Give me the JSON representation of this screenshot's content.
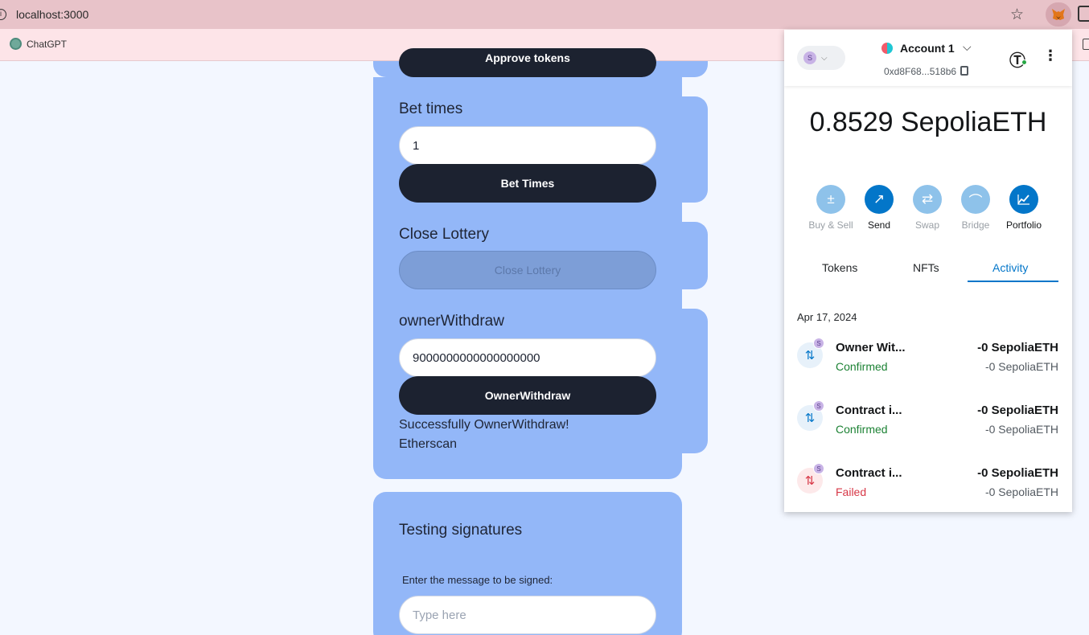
{
  "browser": {
    "url": "localhost:3000",
    "bookmarks": [
      {
        "label": "ChatGPT"
      }
    ]
  },
  "page": {
    "approve_button_partial": "Approve tokens",
    "bet_times": {
      "title": "Bet times",
      "input_value": "1",
      "button": "Bet Times"
    },
    "close_lottery": {
      "title": "Close Lottery",
      "button": "Close Lottery"
    },
    "owner_withdraw": {
      "title": "ownerWithdraw",
      "input_value": "9000000000000000000",
      "button": "OwnerWithdraw",
      "status": "Successfully OwnerWithdraw!",
      "link": "Etherscan"
    },
    "testing_signatures": {
      "title": "Testing signatures",
      "label": "Enter the message to be signed:",
      "placeholder": "Type here"
    }
  },
  "metamask": {
    "network_badge": "S",
    "account_name": "Account 1",
    "address": "0xd8F68...518b6",
    "balance": "0.8529 SepoliaETH",
    "actions": [
      {
        "label": "Buy & Sell",
        "icon": "buy-sell-icon",
        "enabled": false
      },
      {
        "label": "Send",
        "icon": "send-arrow-icon",
        "enabled": true
      },
      {
        "label": "Swap",
        "icon": "swap-icon",
        "enabled": false
      },
      {
        "label": "Bridge",
        "icon": "bridge-icon",
        "enabled": false
      },
      {
        "label": "Portfolio",
        "icon": "chart-icon",
        "enabled": true
      }
    ],
    "tabs": [
      "Tokens",
      "NFTs",
      "Activity"
    ],
    "active_tab": "Activity",
    "date": "Apr 17, 2024",
    "transactions": [
      {
        "name": "Owner Wit...",
        "status": "Confirmed",
        "amount": "-0 SepoliaETH",
        "fiat": "-0 SepoliaETH"
      },
      {
        "name": "Contract i...",
        "status": "Confirmed",
        "amount": "-0 SepoliaETH",
        "fiat": "-0 SepoliaETH"
      },
      {
        "name": "Contract i...",
        "status": "Failed",
        "amount": "-0 SepoliaETH",
        "fiat": "-0 SepoliaETH"
      }
    ],
    "colors": {
      "accent": "#0376c9",
      "success": "#1c8234",
      "error": "#d73847"
    }
  }
}
